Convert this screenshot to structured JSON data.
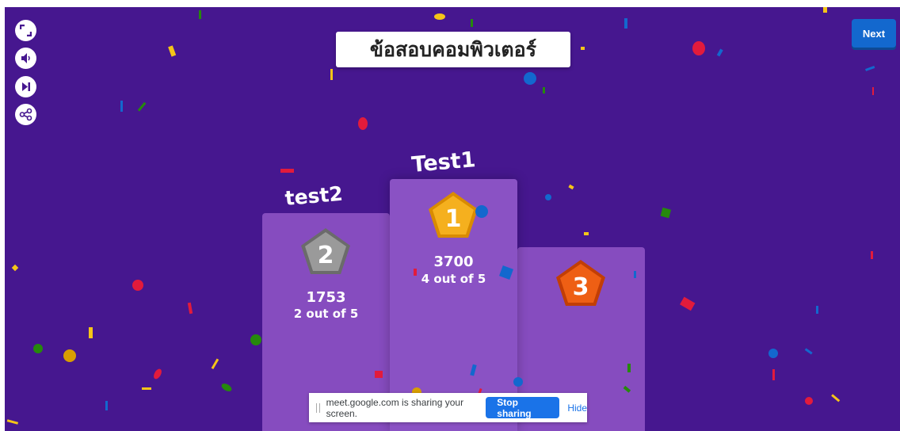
{
  "quiz": {
    "title": "ข้อสอบคอมพิวเตอร์"
  },
  "toolbar": {
    "fullscreen_icon": "fullscreen-icon",
    "volume_icon": "volume-icon",
    "skip_icon": "skip-icon",
    "share_icon": "share-icon"
  },
  "next_label": "Next",
  "podium": {
    "first": {
      "rank": "1",
      "name": "Test1",
      "score": "3700",
      "correct": "4 out of 5"
    },
    "second": {
      "rank": "2",
      "name": "test2",
      "score": "1753",
      "correct": "2 out of 5"
    },
    "third": {
      "rank": "3"
    }
  },
  "screen_share": {
    "message": "meet.google.com is sharing your screen.",
    "stop_label": "Stop sharing",
    "hide_label": "Hide"
  },
  "colors": {
    "background": "#46178f",
    "podium": "#864cbf",
    "gold": "#f0a50a",
    "silver": "#8a8a8a",
    "bronze": "#e8560f",
    "next_button": "#1368ce",
    "stop_button": "#1a73e8"
  }
}
